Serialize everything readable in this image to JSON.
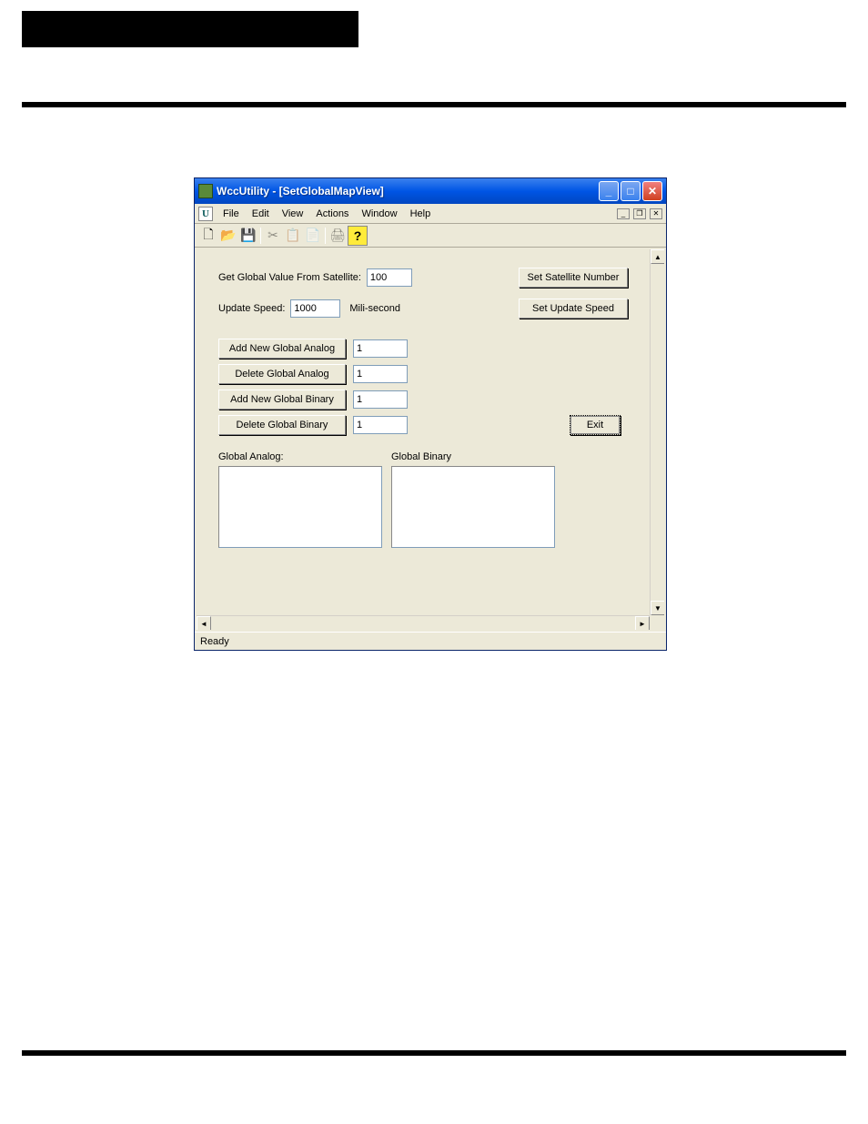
{
  "window": {
    "title": "WccUtility - [SetGlobalMapView]"
  },
  "menu": {
    "file": "File",
    "edit": "Edit",
    "view": "View",
    "actions": "Actions",
    "window": "Window",
    "help": "Help"
  },
  "form": {
    "satellite_label": "Get Global Value From Satellite:",
    "satellite_value": "100",
    "set_satellite_btn": "Set Satellite Number",
    "update_speed_label": "Update Speed:",
    "update_speed_value": "1000",
    "update_speed_unit": "Mili-second",
    "set_update_speed_btn": "Set Update Speed",
    "add_analog_btn": "Add New Global Analog",
    "add_analog_value": "1",
    "del_analog_btn": "Delete Global Analog",
    "del_analog_value": "1",
    "add_binary_btn": "Add New Global Binary",
    "add_binary_value": "1",
    "del_binary_btn": "Delete Global Binary",
    "del_binary_value": "1",
    "exit_btn": "Exit",
    "global_analog_label": "Global Analog:",
    "global_binary_label": "Global Binary"
  },
  "status": {
    "text": "Ready"
  }
}
